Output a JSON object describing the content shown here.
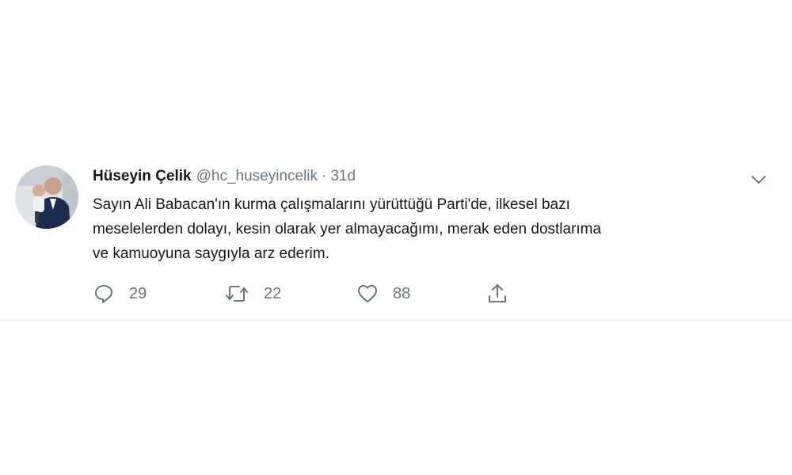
{
  "tweet": {
    "author_name": "Hüseyin Çelik",
    "handle": "@hc_huseyincelik",
    "separator": "·",
    "time": "31d",
    "lines": [
      "Sayın Ali Babacan'ın kurma çalışmalarını yürüttüğü Parti'de, ilkesel bazı",
      "meselelerden dolayı, kesin olarak yer almayacağımı, merak eden dostlarıma",
      "ve kamuoyuna saygıyla arz ederim."
    ],
    "actions": {
      "reply_count": "29",
      "retweet_count": "22",
      "like_count": "88"
    }
  },
  "icons": {
    "avatar": "avatar",
    "caret": "chevron-down-icon",
    "reply": "reply-icon",
    "retweet": "retweet-icon",
    "like": "heart-icon",
    "share": "share-icon"
  },
  "colors": {
    "text_primary": "#14171a",
    "text_secondary": "#657786",
    "divider": "#ebeef0"
  }
}
